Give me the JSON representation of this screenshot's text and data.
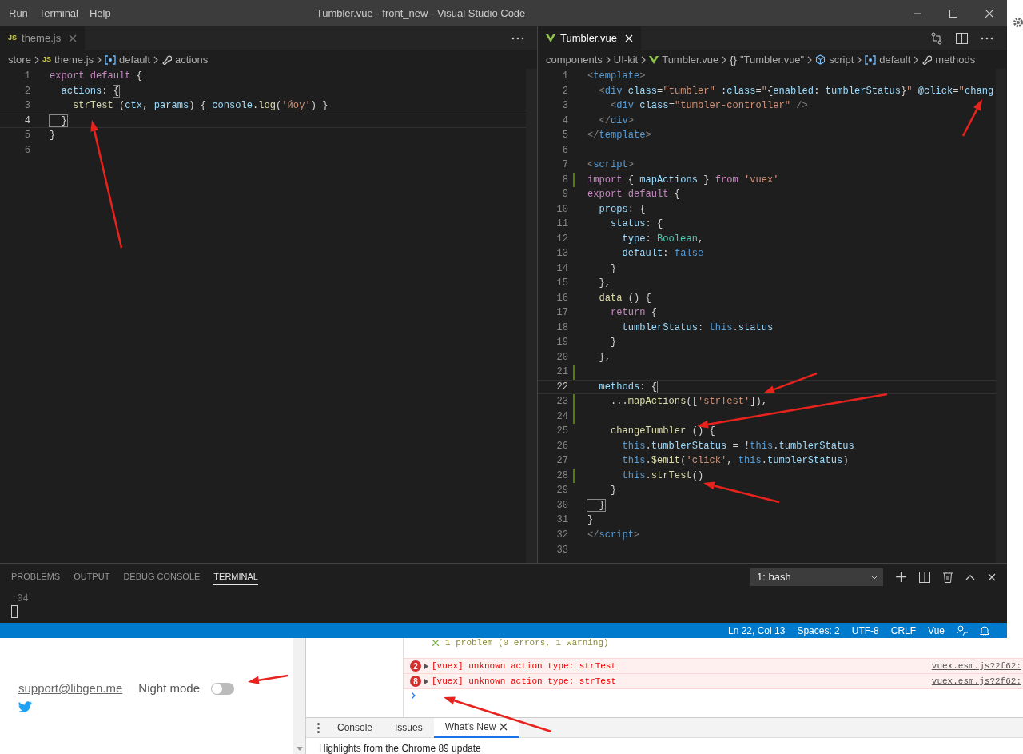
{
  "title_bar": {
    "menu": [
      "Run",
      "Terminal",
      "Help"
    ],
    "title": "Tumbler.vue - front_new - Visual Studio Code"
  },
  "editors": [
    {
      "tab": {
        "badge": "JS",
        "label": "theme.js",
        "focused": false
      },
      "breadcrumbs": [
        {
          "text": "store"
        },
        {
          "prefix": "JS",
          "text": "theme.js"
        },
        {
          "kind": "module",
          "text": "default"
        },
        {
          "kind": "wrench",
          "text": "actions"
        }
      ],
      "lines": [
        {
          "number": "1",
          "current": false,
          "modified": false,
          "tokens": [
            {
              "text": "export default",
              "kind": "keyword"
            },
            {
              "text": " {",
              "kind": "plain"
            }
          ]
        },
        {
          "number": "2",
          "current": false,
          "modified": false,
          "tokens": [
            {
              "text": "  actions",
              "kind": "variable"
            },
            {
              "text": ": ",
              "kind": "plain"
            },
            {
              "text": "{",
              "kind": "match"
            }
          ]
        },
        {
          "number": "3",
          "current": false,
          "modified": false,
          "tokens": [
            {
              "text": "    strTest",
              "kind": "function"
            },
            {
              "text": " (",
              "kind": "plain"
            },
            {
              "text": "ctx",
              "kind": "variable"
            },
            {
              "text": ", ",
              "kind": "plain"
            },
            {
              "text": "params",
              "kind": "variable"
            },
            {
              "text": ") { ",
              "kind": "plain"
            },
            {
              "text": "console",
              "kind": "variable"
            },
            {
              "text": ".",
              "kind": "plain"
            },
            {
              "text": "log",
              "kind": "function"
            },
            {
              "text": "(",
              "kind": "plain"
            },
            {
              "text": "'йоу'",
              "kind": "string"
            },
            {
              "text": ") }",
              "kind": "plain"
            }
          ]
        },
        {
          "number": "4",
          "current": true,
          "modified": false,
          "tokens": [
            {
              "text": "  }",
              "kind": "match"
            }
          ]
        },
        {
          "number": "5",
          "current": false,
          "modified": false,
          "tokens": [
            {
              "text": "}",
              "kind": "plain"
            }
          ]
        },
        {
          "number": "6",
          "current": false,
          "modified": false
        }
      ]
    },
    {
      "tab": {
        "kind": "vue",
        "label": "Tumbler.vue",
        "focused": true
      },
      "breadcrumbs": [
        {
          "text": "components"
        },
        {
          "text": "UI-kit"
        },
        {
          "kind": "vue",
          "text": "Tumbler.vue"
        },
        {
          "prefix": "{}",
          "text": "\"Tumbler.vue\""
        },
        {
          "kind": "cube",
          "text": "script"
        },
        {
          "kind": "module",
          "text": "default"
        },
        {
          "kind": "wrench",
          "text": "methods"
        }
      ],
      "lines": [
        {
          "number": "1",
          "current": false,
          "modified": false,
          "tokens": [
            {
              "text": "<",
              "kind": "tag-punct"
            },
            {
              "text": "template",
              "kind": "tag"
            },
            {
              "text": ">",
              "kind": "tag-punct"
            }
          ]
        },
        {
          "number": "2",
          "current": false,
          "modified": false,
          "tokens": [
            {
              "text": "  <",
              "kind": "tag-punct"
            },
            {
              "text": "div",
              "kind": "tag"
            },
            {
              "text": " class",
              "kind": "variable"
            },
            {
              "text": "=",
              "kind": "plain"
            },
            {
              "text": "\"tumbler\"",
              "kind": "string"
            },
            {
              "text": " :class",
              "kind": "variable"
            },
            {
              "text": "=",
              "kind": "plain"
            },
            {
              "text": "\"",
              "kind": "string"
            },
            {
              "text": "{",
              "kind": "plain"
            },
            {
              "text": "enabled",
              "kind": "variable"
            },
            {
              "text": ": ",
              "kind": "plain"
            },
            {
              "text": "tumblerStatus",
              "kind": "variable"
            },
            {
              "text": "}",
              "kind": "plain"
            },
            {
              "text": "\"",
              "kind": "string"
            },
            {
              "text": " @click",
              "kind": "variable"
            },
            {
              "text": "=",
              "kind": "plain"
            },
            {
              "text": "\"",
              "kind": "string"
            },
            {
              "text": "chang",
              "kind": "variable"
            }
          ]
        },
        {
          "number": "3",
          "current": false,
          "modified": false,
          "tokens": [
            {
              "text": "    <",
              "kind": "tag-punct"
            },
            {
              "text": "div",
              "kind": "tag"
            },
            {
              "text": " class",
              "kind": "variable"
            },
            {
              "text": "=",
              "kind": "plain"
            },
            {
              "text": "\"tumbler-controller\"",
              "kind": "string"
            },
            {
              "text": " />",
              "kind": "tag-punct"
            }
          ]
        },
        {
          "number": "4",
          "current": false,
          "modified": false,
          "tokens": [
            {
              "text": "  </",
              "kind": "tag-punct"
            },
            {
              "text": "div",
              "kind": "tag"
            },
            {
              "text": ">",
              "kind": "tag-punct"
            }
          ]
        },
        {
          "number": "5",
          "current": false,
          "modified": false,
          "tokens": [
            {
              "text": "</",
              "kind": "tag-punct"
            },
            {
              "text": "template",
              "kind": "tag"
            },
            {
              "text": ">",
              "kind": "tag-punct"
            }
          ]
        },
        {
          "number": "6",
          "current": false,
          "modified": false
        },
        {
          "number": "7",
          "current": false,
          "modified": false,
          "tokens": [
            {
              "text": "<",
              "kind": "tag-punct"
            },
            {
              "text": "script",
              "kind": "tag"
            },
            {
              "text": ">",
              "kind": "tag-punct"
            }
          ]
        },
        {
          "number": "8",
          "current": false,
          "modified": true,
          "tokens": [
            {
              "text": "import",
              "kind": "keyword"
            },
            {
              "text": " { ",
              "kind": "plain"
            },
            {
              "text": "mapActions",
              "kind": "variable"
            },
            {
              "text": " } ",
              "kind": "plain"
            },
            {
              "text": "from",
              "kind": "keyword"
            },
            {
              "text": " 'vuex'",
              "kind": "string"
            }
          ]
        },
        {
          "number": "9",
          "current": false,
          "modified": false,
          "tokens": [
            {
              "text": "export default",
              "kind": "keyword"
            },
            {
              "text": " {",
              "kind": "plain"
            }
          ]
        },
        {
          "number": "10",
          "current": false,
          "modified": false,
          "tokens": [
            {
              "text": "  props",
              "kind": "variable"
            },
            {
              "text": ": {",
              "kind": "plain"
            }
          ]
        },
        {
          "number": "11",
          "current": false,
          "modified": false,
          "tokens": [
            {
              "text": "    status",
              "kind": "variable"
            },
            {
              "text": ": {",
              "kind": "plain"
            }
          ]
        },
        {
          "number": "12",
          "current": false,
          "modified": false,
          "tokens": [
            {
              "text": "      type",
              "kind": "variable"
            },
            {
              "text": ": ",
              "kind": "plain"
            },
            {
              "text": "Boolean",
              "kind": "type"
            },
            {
              "text": ",",
              "kind": "plain"
            }
          ]
        },
        {
          "number": "13",
          "current": false,
          "modified": false,
          "tokens": [
            {
              "text": "      default",
              "kind": "variable"
            },
            {
              "text": ": ",
              "kind": "plain"
            },
            {
              "text": "false",
              "kind": "constant"
            }
          ]
        },
        {
          "number": "14",
          "current": false,
          "modified": false,
          "tokens": [
            {
              "text": "    }",
              "kind": "plain"
            }
          ]
        },
        {
          "number": "15",
          "current": false,
          "modified": false,
          "tokens": [
            {
              "text": "  },",
              "kind": "plain"
            }
          ]
        },
        {
          "number": "16",
          "current": false,
          "modified": false,
          "tokens": [
            {
              "text": "  data",
              "kind": "function"
            },
            {
              "text": " () {",
              "kind": "plain"
            }
          ]
        },
        {
          "number": "17",
          "current": false,
          "modified": false,
          "tokens": [
            {
              "text": "    return",
              "kind": "keyword"
            },
            {
              "text": " {",
              "kind": "plain"
            }
          ]
        },
        {
          "number": "18",
          "current": false,
          "modified": false,
          "tokens": [
            {
              "text": "      tumblerStatus",
              "kind": "variable"
            },
            {
              "text": ": ",
              "kind": "plain"
            },
            {
              "text": "this",
              "kind": "constant"
            },
            {
              "text": ".",
              "kind": "plain"
            },
            {
              "text": "status",
              "kind": "variable"
            }
          ]
        },
        {
          "number": "19",
          "current": false,
          "modified": false,
          "tokens": [
            {
              "text": "    }",
              "kind": "plain"
            }
          ]
        },
        {
          "number": "20",
          "current": false,
          "modified": false,
          "tokens": [
            {
              "text": "  },",
              "kind": "plain"
            }
          ]
        },
        {
          "number": "21",
          "current": false,
          "modified": true
        },
        {
          "number": "22",
          "current": true,
          "modified": false,
          "tokens": [
            {
              "text": "  methods",
              "kind": "variable"
            },
            {
              "text": ": ",
              "kind": "plain"
            },
            {
              "text": "{",
              "kind": "match"
            }
          ]
        },
        {
          "number": "23",
          "current": false,
          "modified": true,
          "tokens": [
            {
              "text": "    ...",
              "kind": "plain"
            },
            {
              "text": "mapActions",
              "kind": "function"
            },
            {
              "text": "([",
              "kind": "plain"
            },
            {
              "text": "'strTest'",
              "kind": "string"
            },
            {
              "text": "]),",
              "kind": "plain"
            }
          ]
        },
        {
          "number": "24",
          "current": false,
          "modified": true
        },
        {
          "number": "25",
          "current": false,
          "modified": false,
          "tokens": [
            {
              "text": "    changeTumbler",
              "kind": "function"
            },
            {
              "text": " () {",
              "kind": "plain"
            }
          ]
        },
        {
          "number": "26",
          "current": false,
          "modified": false,
          "tokens": [
            {
              "text": "      this",
              "kind": "constant"
            },
            {
              "text": ".",
              "kind": "plain"
            },
            {
              "text": "tumblerStatus",
              "kind": "variable"
            },
            {
              "text": " = !",
              "kind": "plain"
            },
            {
              "text": "this",
              "kind": "constant"
            },
            {
              "text": ".",
              "kind": "plain"
            },
            {
              "text": "tumblerStatus",
              "kind": "variable"
            }
          ]
        },
        {
          "number": "27",
          "current": false,
          "modified": false,
          "tokens": [
            {
              "text": "      this",
              "kind": "constant"
            },
            {
              "text": ".",
              "kind": "plain"
            },
            {
              "text": "$emit",
              "kind": "function"
            },
            {
              "text": "(",
              "kind": "plain"
            },
            {
              "text": "'click'",
              "kind": "string"
            },
            {
              "text": ", ",
              "kind": "plain"
            },
            {
              "text": "this",
              "kind": "constant"
            },
            {
              "text": ".",
              "kind": "plain"
            },
            {
              "text": "tumblerStatus",
              "kind": "variable"
            },
            {
              "text": ")",
              "kind": "plain"
            }
          ]
        },
        {
          "number": "28",
          "current": false,
          "modified": true,
          "tokens": [
            {
              "text": "      this",
              "kind": "constant"
            },
            {
              "text": ".",
              "kind": "plain"
            },
            {
              "text": "strTest",
              "kind": "function"
            },
            {
              "text": "()",
              "kind": "plain"
            }
          ]
        },
        {
          "number": "29",
          "current": false,
          "modified": false,
          "tokens": [
            {
              "text": "    }",
              "kind": "plain"
            }
          ]
        },
        {
          "number": "30",
          "current": false,
          "modified": false,
          "tokens": [
            {
              "text": "  }",
              "kind": "match"
            }
          ]
        },
        {
          "number": "31",
          "current": false,
          "modified": false,
          "tokens": [
            {
              "text": "}",
              "kind": "plain"
            }
          ]
        },
        {
          "number": "32",
          "current": false,
          "modified": false,
          "tokens": [
            {
              "text": "</",
              "kind": "tag-punct"
            },
            {
              "text": "script",
              "kind": "tag"
            },
            {
              "text": ">",
              "kind": "tag-punct"
            }
          ]
        },
        {
          "number": "33",
          "current": false,
          "modified": false
        }
      ]
    }
  ],
  "panel": {
    "tabs": [
      {
        "label": "PROBLEMS",
        "selected": false
      },
      {
        "label": "OUTPUT",
        "selected": false
      },
      {
        "label": "DEBUG CONSOLE",
        "selected": false
      },
      {
        "label": "TERMINAL",
        "selected": true
      }
    ],
    "terminal_select": "1: bash",
    "terminal_output": ":04"
  },
  "status_bar": [
    "Ln 22, Col 13",
    "Spaces: 2",
    "UTF-8",
    "CRLF",
    "Vue"
  ],
  "web_page": {
    "email": "support@libgen.me",
    "night_mode": {
      "label": "Night mode",
      "on": false
    }
  },
  "devtools": {
    "summary": "1 problem (0 errors, 1 warning)",
    "messages": [
      {
        "count": "2",
        "text": "[vuex] unknown action type: strTest",
        "source": "vuex.esm.js?2f62:"
      },
      {
        "count": "8",
        "text": "[vuex] unknown action type: strTest",
        "source": "vuex.esm.js?2f62:"
      }
    ],
    "drawer_tabs": [
      {
        "label": "Console",
        "selected": false
      },
      {
        "label": "Issues",
        "selected": false
      },
      {
        "label": "What's New",
        "selected": true
      }
    ],
    "drawer_text": "Highlights from the Chrome 89 update"
  }
}
